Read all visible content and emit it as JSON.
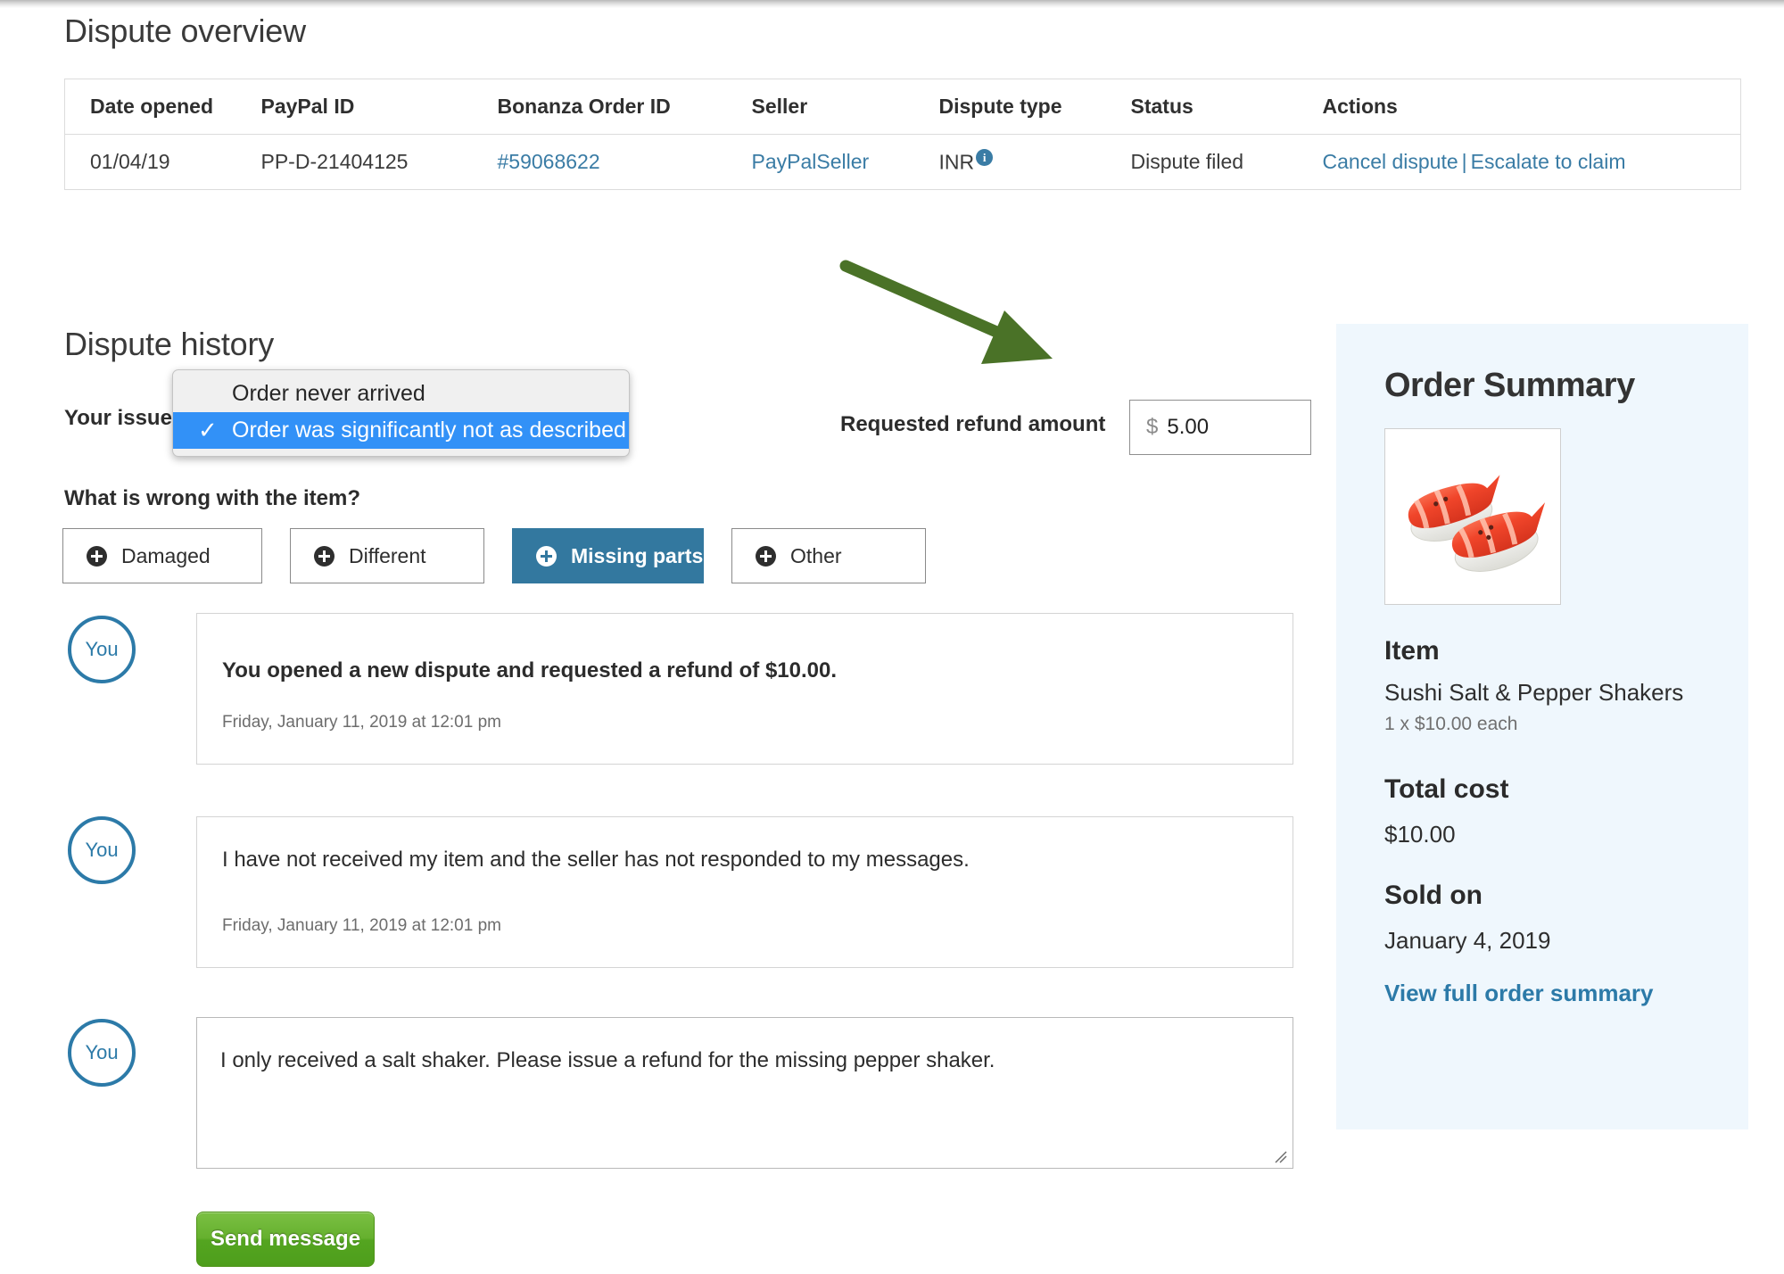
{
  "overview": {
    "title": "Dispute overview",
    "columns": [
      "Date opened",
      "PayPal ID",
      "Bonanza Order ID",
      "Seller",
      "Dispute type",
      "Status",
      "Actions"
    ],
    "row": {
      "date_opened": "01/04/19",
      "paypal_id": "PP-D-21404125",
      "bonanza_order_id": "#59068622",
      "seller": "PayPalSeller",
      "dispute_type": "INR",
      "dispute_type_info_icon": "info-icon",
      "status": "Dispute filed",
      "action_cancel": "Cancel dispute",
      "action_separator": "|",
      "action_escalate": "Escalate to claim"
    }
  },
  "history": {
    "title": "Dispute history",
    "your_issue_label": "Your issue",
    "issue_dropdown": {
      "options": [
        {
          "label": "Order never arrived",
          "selected": false
        },
        {
          "label": "Order was significantly not as described",
          "selected": true
        }
      ],
      "check_glyph": "✓"
    },
    "refund_label": "Requested refund amount",
    "refund_currency": "$",
    "refund_value": "5.00",
    "wrong_label": "What is wrong with the item?",
    "wrong_options": [
      {
        "label": "Damaged",
        "active": false,
        "icon": "plus-circle-icon"
      },
      {
        "label": "Different",
        "active": false,
        "icon": "plus-circle-icon"
      },
      {
        "label": "Missing parts",
        "active": true,
        "icon": "plus-circle-icon"
      },
      {
        "label": "Other",
        "active": false,
        "icon": "plus-circle-icon"
      }
    ],
    "messages": [
      {
        "avatar": "You",
        "text": "You opened a new dispute and requested a refund of $10.00.",
        "timestamp": "Friday, January 11, 2019 at 12:01 pm",
        "bold": true
      },
      {
        "avatar": "You",
        "text": "I have not received my item and the seller has not responded to my messages.",
        "timestamp": "Friday, January 11, 2019 at 12:01 pm",
        "bold": false
      },
      {
        "avatar": "You",
        "text": "I only received a salt shaker. Please issue a refund for the missing pepper shaker.",
        "timestamp": "",
        "bold": false
      }
    ],
    "send_button": "Send message"
  },
  "order_summary": {
    "title": "Order Summary",
    "thumbnail_alt": "sushi-salt-and-pepper-shakers-thumbnail",
    "item_heading": "Item",
    "item_name": "Sushi Salt & Pepper Shakers",
    "item_qty_price": "1 x $10.00 each",
    "total_heading": "Total cost",
    "total_value": "$10.00",
    "sold_heading": "Sold on",
    "sold_value": "January 4, 2019",
    "view_full_link": "View full order summary"
  },
  "colors": {
    "link_blue": "#3a7ca5",
    "accent_blue": "#33789f",
    "dropdown_highlight": "#3291f7",
    "sidebar_bg": "#eff7fd",
    "send_green": "#54a520",
    "arrow_green": "#4a7227"
  }
}
